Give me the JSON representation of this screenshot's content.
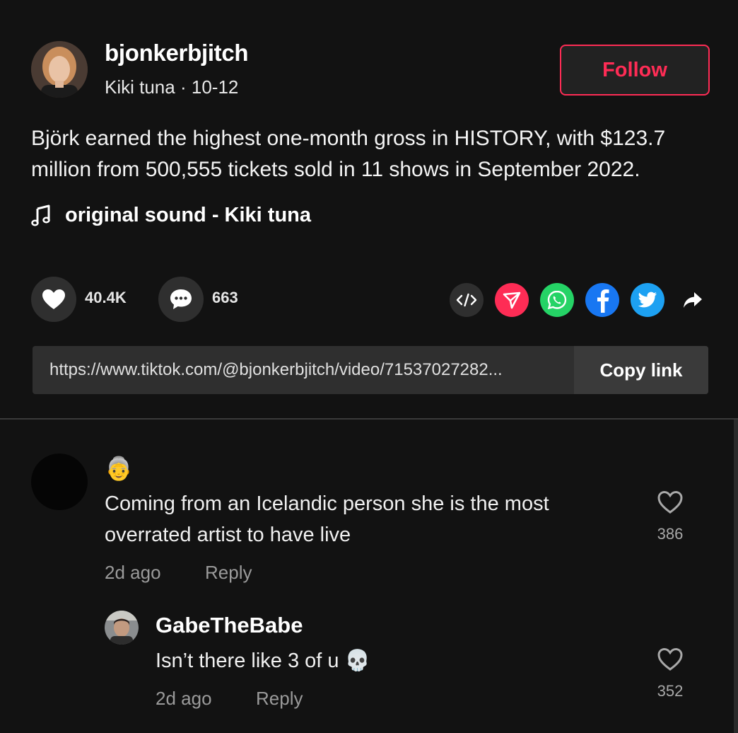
{
  "post": {
    "username": "bjonkerbjitch",
    "display_name": "Kiki tuna",
    "separator": "·",
    "date": "10-12",
    "follow_label": "Follow",
    "description": "Björk earned the highest one-month gross in HISTORY, with $123.7 million from 500,555 tickets sold in 11 shows in September 2022.",
    "sound": "original sound - Kiki tuna",
    "likes": "40.4K",
    "comments": "663",
    "link": "https://www.tiktok.com/@bjonkerbjitch/video/71537027282...",
    "copy_label": "Copy link"
  },
  "share_icons": [
    "embed-icon",
    "send-icon",
    "whatsapp-icon",
    "facebook-icon",
    "twitter-icon",
    "share-arrow-icon"
  ],
  "colors": {
    "background": "#121212",
    "accent": "#fe2c55",
    "whatsapp": "#25d366",
    "facebook": "#1877f2",
    "twitter": "#1da1f2"
  },
  "comments": [
    {
      "emoji": "👵",
      "text_line1": "Coming from an Icelandic person she is the most",
      "text_line2": "overrated artist to have live",
      "time": "2d ago",
      "reply_label": "Reply",
      "likes": "386"
    },
    {
      "username": "GabeTheBabe",
      "text": "Isn’t there like 3 of u 💀",
      "time": "2d ago",
      "reply_label": "Reply",
      "likes": "352"
    }
  ]
}
